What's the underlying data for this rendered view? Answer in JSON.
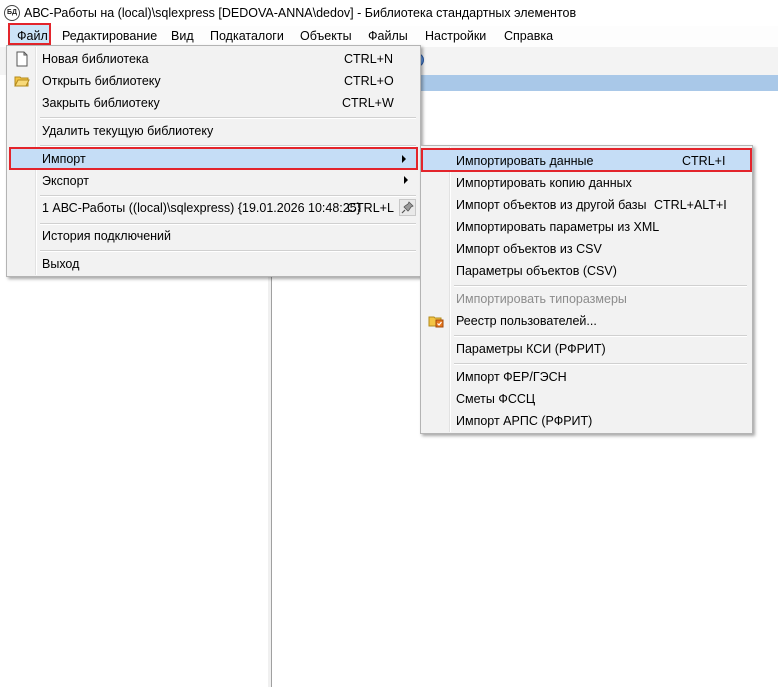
{
  "window": {
    "icon_text": "БД",
    "title": "АВС-Работы на (local)\\sqlexpress [DEDOVA-ANNA\\dedov] - Библиотека стандартных элементов"
  },
  "menubar": {
    "items": [
      "Файл",
      "Редактирование",
      "Вид",
      "Подкаталоги",
      "Объекты",
      "Файлы",
      "Настройки",
      "Справка"
    ]
  },
  "file_menu": {
    "items": [
      {
        "label": "Новая библиотека",
        "shortcut": "CTRL+N"
      },
      {
        "label": "Открыть библиотеку",
        "shortcut": "CTRL+O"
      },
      {
        "label": "Закрыть библиотеку",
        "shortcut": "CTRL+W"
      },
      {
        "label": "Удалить текущую библиотеку",
        "shortcut": ""
      },
      {
        "label": "Импорт",
        "shortcut": ""
      },
      {
        "label": "Экспорт",
        "shortcut": ""
      },
      {
        "label": "1 АВС-Работы ((local)\\sqlexpress) {19.01.2026 10:48:25}",
        "shortcut": "CTRL+L"
      },
      {
        "label": "История подключений",
        "shortcut": ""
      },
      {
        "label": "Выход",
        "shortcut": ""
      }
    ]
  },
  "import_submenu": {
    "items": [
      {
        "label": "Импортировать данные",
        "shortcut": "CTRL+I"
      },
      {
        "label": "Импортировать копию данных",
        "shortcut": ""
      },
      {
        "label": "Импорт объектов из другой базы",
        "shortcut": "CTRL+ALT+I"
      },
      {
        "label": "Импортировать параметры из XML",
        "shortcut": ""
      },
      {
        "label": "Импорт объектов из CSV",
        "shortcut": ""
      },
      {
        "label": "Параметры объектов (CSV)",
        "shortcut": ""
      },
      {
        "label": "Импортировать типоразмеры",
        "shortcut": ""
      },
      {
        "label": "Реестр пользователей...",
        "shortcut": ""
      },
      {
        "label": "Параметры КСИ (РФРИТ)",
        "shortcut": ""
      },
      {
        "label": "Импорт ФЕР/ГЭСН",
        "shortcut": ""
      },
      {
        "label": "Сметы ФССЦ",
        "shortcut": ""
      },
      {
        "label": "Импорт АРПС (РФРИТ)",
        "shortcut": ""
      }
    ]
  },
  "colors": {
    "highlight": "#c5ddf6",
    "annotation_red": "#e3242b",
    "header_blue": "#a9c8e8"
  }
}
